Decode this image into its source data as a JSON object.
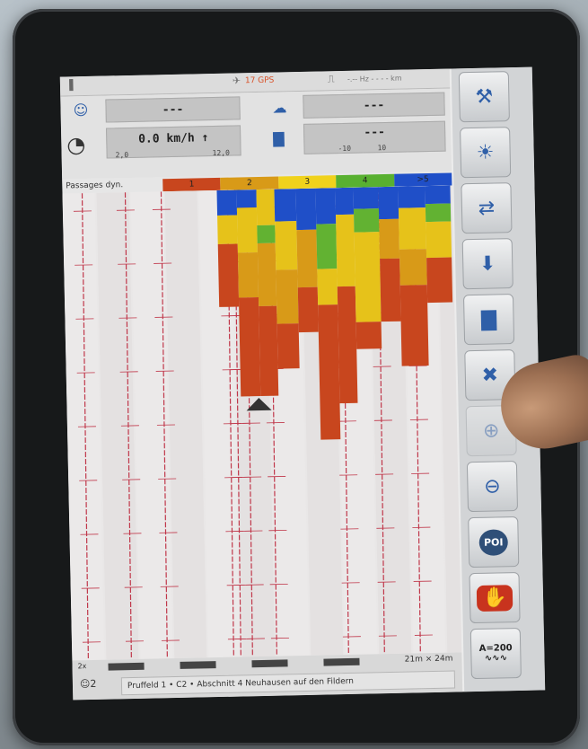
{
  "status": {
    "gps_text": "17 GPS",
    "hz_text": "-.-- Hz  - - - - km"
  },
  "info": {
    "top_value": "---",
    "speed": "0.0 km/h ↑",
    "speed_min": "2,0",
    "speed_max": "12,0",
    "right_top_value": "---",
    "right_bottom_value": "---",
    "right_min": "-10",
    "right_max": "10"
  },
  "passages": {
    "label": "Passages dyn.",
    "scale": [
      {
        "label": "1",
        "color": "#c8461e"
      },
      {
        "label": "2",
        "color": "#d89a18"
      },
      {
        "label": "3",
        "color": "#f0d21c"
      },
      {
        "label": "4",
        "color": "#58b030"
      },
      {
        "label": ">5",
        "color": "#1f4fc8"
      }
    ]
  },
  "colors": {
    "red": "#c8461e",
    "orange": "#d89a18",
    "yellow": "#e6c21a",
    "green": "#62b232",
    "blue": "#1f4fc8",
    "track": "#c0374a"
  },
  "map": {
    "ratio": "21m × 24m",
    "zoom": "2x"
  },
  "footer": {
    "users": "2",
    "field_text": "Pruffeld 1 • C2 • Abschnitt 4  Neuhausen auf den Fildern"
  },
  "toolbar": {
    "buttons": [
      {
        "name": "settings-tools-icon",
        "glyph": "⚒"
      },
      {
        "name": "lightbulb-icon",
        "glyph": "☀"
      },
      {
        "name": "signal-switch-icon",
        "glyph": "⇄"
      },
      {
        "name": "download-layer-icon",
        "glyph": "⬇"
      },
      {
        "name": "signal-bars-icon",
        "glyph": "▇"
      },
      {
        "name": "fit-screen-icon",
        "glyph": "✖"
      },
      {
        "name": "zoom-in-icon",
        "glyph": "⊕"
      },
      {
        "name": "zoom-out-icon",
        "glyph": "⊖"
      },
      {
        "name": "poi-marker-icon",
        "glyph": "POI"
      },
      {
        "name": "stop-hand-icon",
        "glyph": "✋"
      }
    ],
    "last_button_label": "A=200"
  }
}
